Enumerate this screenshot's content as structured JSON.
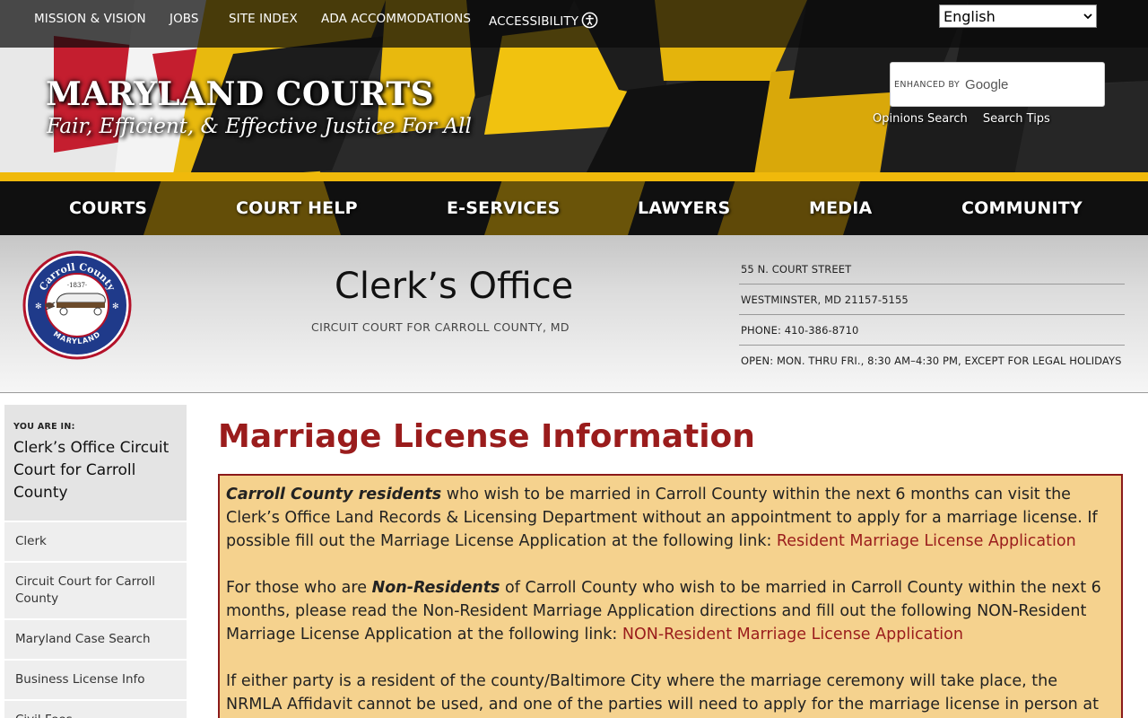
{
  "utility_nav": {
    "mission": "MISSION & VISION",
    "jobs": "JOBS",
    "site_index": "SITE INDEX",
    "ada": "ADA ACCOMMODATIONS",
    "accessibility": "ACCESSIBILITY"
  },
  "language": {
    "selected": "English"
  },
  "brand": {
    "title": "MARYLAND COURTS",
    "tagline": "Fair, Efficient, & Effective Justice For All"
  },
  "search": {
    "enhanced_by": "ENHANCED BY",
    "provider": "Google",
    "opinions_link": "Opinions Search",
    "tips_link": "Search Tips"
  },
  "main_nav": {
    "courts": "COURTS",
    "court_help": "COURT HELP",
    "eservices": "E-SERVICES",
    "lawyers": "LAWYERS",
    "media": "MEDIA",
    "community": "COMMUNITY"
  },
  "office": {
    "title": "Clerk’s Office",
    "subtitle": "CIRCUIT COURT FOR CARROLL COUNTY, MD",
    "seal_top": "Carroll County",
    "seal_year": "·1837·",
    "seal_bottom": "MARYLAND",
    "contact": {
      "street": "55 N. COURT STREET",
      "city": "WESTMINSTER, MD 21157-5155",
      "phone": "PHONE: 410-386-8710",
      "hours": "OPEN: MON. THRU FRI., 8:30 AM–4:30 PM, EXCEPT FOR LEGAL HOLIDAYS"
    }
  },
  "sidebar": {
    "you_are_in": "YOU ARE IN:",
    "current": "Clerk’s Office Circuit Court for Carroll County",
    "items": [
      {
        "label": "Clerk"
      },
      {
        "label": "Circuit Court for Carroll County"
      },
      {
        "label": "Maryland Case Search"
      },
      {
        "label": "Business License Info"
      },
      {
        "label": "Civil Fees"
      }
    ]
  },
  "main": {
    "title": "Marriage License Information",
    "p1": {
      "em": "Carroll County residents",
      "text": " who wish to be married in Carroll County within the next 6 months can visit the Clerk’s Office Land Records & Licensing Department without an appointment to apply for a marriage license.  If possible fill out the Marriage License Application at the following link:  ",
      "link": "Resident Marriage License Application"
    },
    "p2": {
      "pre": "For those who are ",
      "em": "Non-Residents",
      "text": " of Carroll County who wish to be married in Carroll County within the next 6 months, please read the Non-Resident Marriage Application directions and fill out the following NON-Resident Marriage License Application at the following link: ",
      "link": "NON-Resident Marriage License Application"
    },
    "p3": {
      "text": "If either party is a resident of the county/Baltimore City where the marriage ceremony will take place, the NRMLA Affidavit cannot be used, and one of the parties will need to apply for the marriage license in person at the Clerk’s"
    }
  },
  "colors": {
    "accent_red": "#9a1c1c",
    "gold": "#f0b90b",
    "notice_bg": "#f5d28e"
  }
}
